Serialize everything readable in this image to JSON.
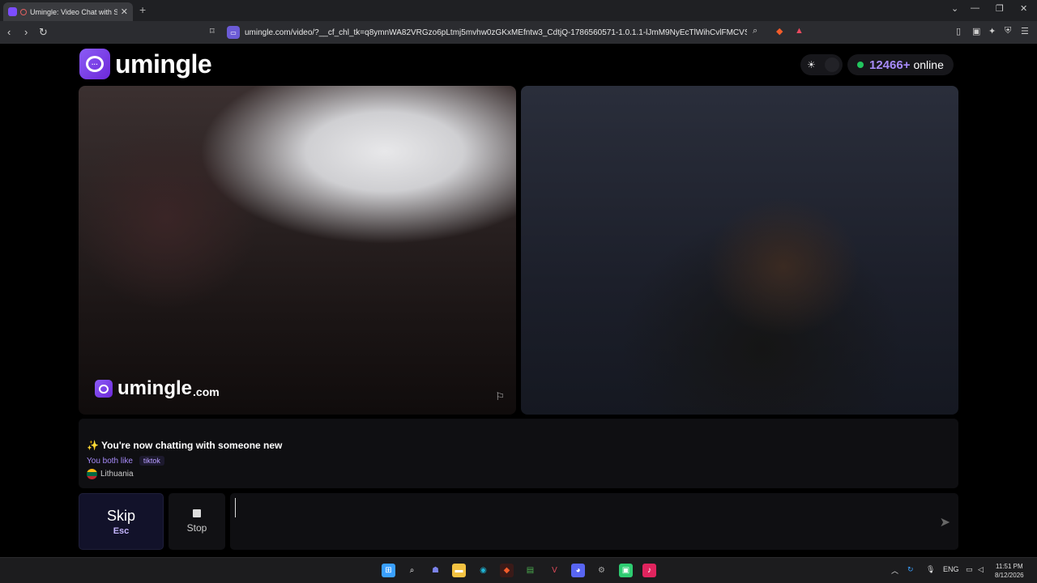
{
  "browser": {
    "tab_title": "Umingle: Video Chat with Str",
    "tab_close": "✕",
    "new_tab": "+",
    "url": "umingle.com/video/?__cf_chl_tk=q8ymnWA82VRGzo6pLtmj5mvhw0zGKxMEfntw3_CdtjQ-1786560571-1.0.1.1-lJmM9NyEcTlWihCvlFMCVSfBK6Dm4u...",
    "controls": {
      "dropdown": "⌄",
      "minimize": "—",
      "restore": "❐",
      "close": "✕"
    },
    "nav": {
      "back": "‹",
      "forward": "›",
      "reload": "↻"
    }
  },
  "header": {
    "logo_text": "umingle",
    "online_count": "12466+",
    "online_label": "online",
    "theme_icon": "sun-icon"
  },
  "video_left": {
    "watermark_text": "umingle",
    "watermark_suffix": ".com",
    "report_icon": "flag-icon"
  },
  "info": {
    "message": "✨ You're now chatting with someone new",
    "likes_label": "You both like",
    "likes_tag": "tiktok",
    "country": "Lithuania"
  },
  "controls": {
    "skip_label": "Skip",
    "skip_shortcut": "Esc",
    "stop_label": "Stop",
    "chat_value": ""
  },
  "taskbar": {
    "lang": "ENG",
    "time": "11:51 PM",
    "date": "8/12/2026"
  },
  "colors": {
    "brand": "#7c4dff",
    "accent_text": "#a78bfa",
    "online_dot": "#22c55e"
  }
}
